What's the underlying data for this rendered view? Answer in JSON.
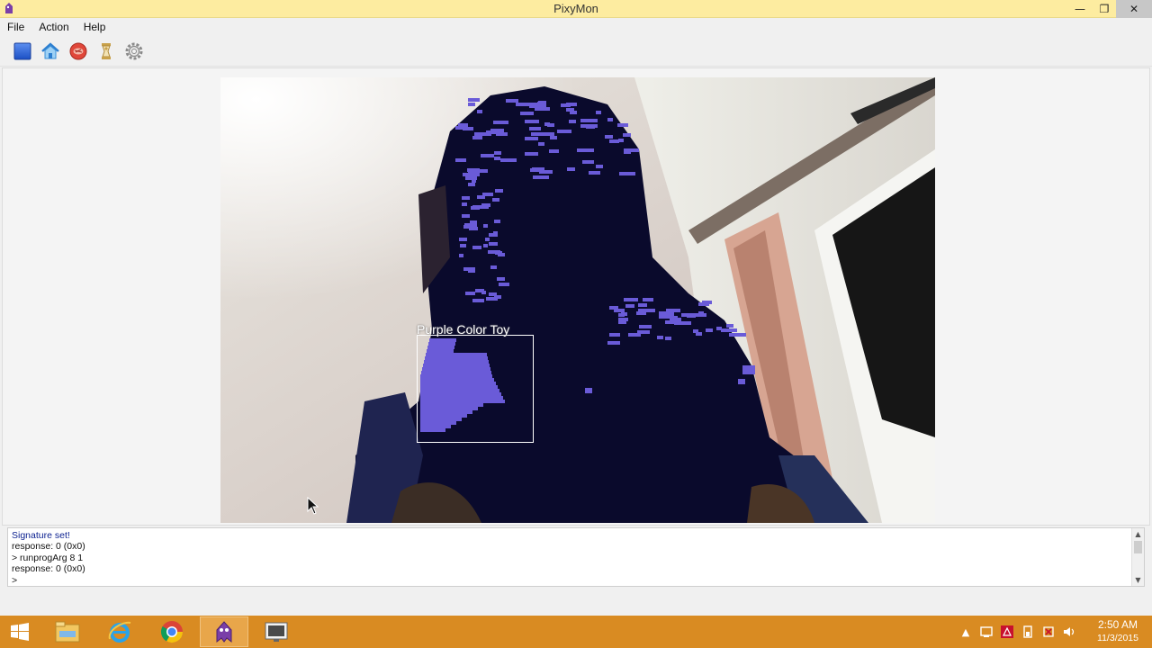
{
  "window": {
    "title": "PixyMon",
    "min_glyph": "—",
    "max_glyph": "❐",
    "close_glyph": "✕"
  },
  "menu": [
    "File",
    "Action",
    "Help"
  ],
  "toolbar": {
    "icons": [
      "stop-icon",
      "home-icon",
      "raw-video-icon",
      "default-program-icon",
      "settings-icon"
    ]
  },
  "video": {
    "signature_label": "Purple Color Toy",
    "colors": {
      "signature": "#6a5bd8",
      "dark": "#0a0a2c"
    }
  },
  "console": {
    "lines": [
      {
        "text": "Signature set!",
        "style": "blue"
      },
      {
        "text": "response: 0 (0x0)",
        "style": "normal"
      },
      {
        "text": "> runprogArg 8 1",
        "style": "normal"
      },
      {
        "text": "response: 0 (0x0)",
        "style": "normal"
      },
      {
        "text": ">",
        "style": "normal"
      }
    ],
    "up_glyph": "▲",
    "down_glyph": "▼"
  },
  "taskbar": {
    "items": [
      "windows-start-icon",
      "file-explorer-icon",
      "internet-explorer-icon",
      "chrome-icon",
      "pixymon-icon",
      "media-app-icon"
    ],
    "tray": {
      "chevron": "▲"
    },
    "clock": {
      "time": "2:50 AM",
      "date": "11/3/2015"
    }
  }
}
